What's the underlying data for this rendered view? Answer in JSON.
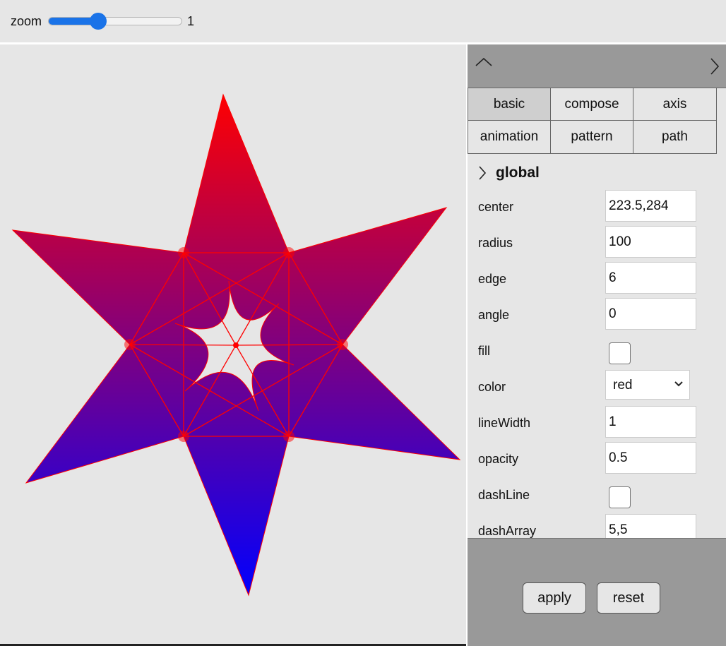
{
  "toolbar": {
    "zoom_label": "zoom",
    "zoom_value": "1",
    "zoom_fraction": 0.37,
    "accent_color": "#1a73e8"
  },
  "panel": {
    "header_icons": [
      "chevron-up-icon",
      "chevron-right-icon"
    ],
    "tabs": [
      {
        "label": "basic",
        "active": true
      },
      {
        "label": "compose",
        "active": false
      },
      {
        "label": "axis",
        "active": false
      },
      {
        "label": "animation",
        "active": false
      },
      {
        "label": "pattern",
        "active": false
      },
      {
        "label": "path",
        "active": false
      }
    ],
    "section_title": "global",
    "fields": {
      "center": {
        "label": "center",
        "value": "223.5,284"
      },
      "radius": {
        "label": "radius",
        "value": "100"
      },
      "edge": {
        "label": "edge",
        "value": "6"
      },
      "angle": {
        "label": "angle",
        "value": "0"
      },
      "fill": {
        "label": "fill",
        "checked": false
      },
      "color": {
        "label": "color",
        "value": "red"
      },
      "lineWidth": {
        "label": "lineWidth",
        "value": "1"
      },
      "opacity": {
        "label": "opacity",
        "value": "0.5"
      },
      "dashLine": {
        "label": "dashLine",
        "checked": false
      },
      "dashArray": {
        "label": "dashArray",
        "value": "5,5"
      }
    },
    "buttons": {
      "apply": "apply",
      "reset": "reset"
    }
  },
  "canvas": {
    "gradient_top": "#ff0000",
    "gradient_bottom": "#0000ff",
    "stroke_color": "#ff0000",
    "point_opacity": 0.5
  }
}
